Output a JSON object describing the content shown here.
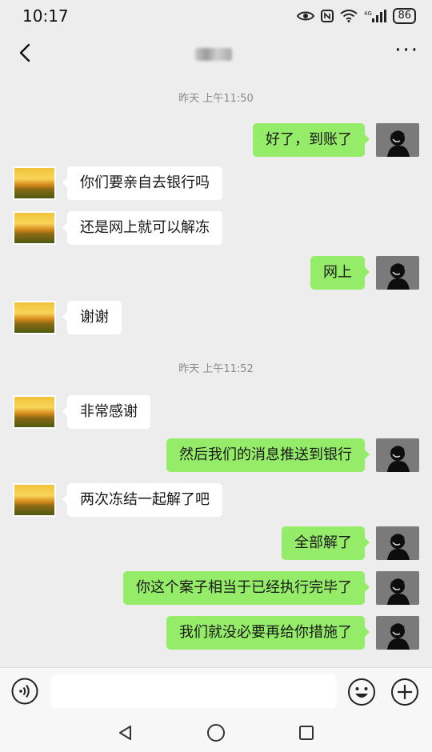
{
  "status_bar": {
    "time": "10:17",
    "icons": [
      "eye-icon",
      "nfc-icon",
      "wifi-icon",
      "signal-4g-icon"
    ],
    "battery": "86"
  },
  "header": {
    "back_icon": "chevron-left-icon",
    "more_icon": "more-dots-icon",
    "more_label": "···"
  },
  "chat": {
    "timestamps": [
      "昨天 上午11:50",
      "昨天 上午11:52"
    ],
    "messages": [
      {
        "side": "right",
        "text": "好了，到账了"
      },
      {
        "side": "left",
        "text": "你们要亲自去银行吗"
      },
      {
        "side": "left",
        "text": "还是网上就可以解冻"
      },
      {
        "side": "right",
        "text": "网上"
      },
      {
        "side": "left",
        "text": "谢谢"
      },
      {
        "side": "left",
        "text": "非常感谢"
      },
      {
        "side": "right",
        "text": "然后我们的消息推送到银行"
      },
      {
        "side": "left",
        "text": "两次冻结一起解了吧"
      },
      {
        "side": "right",
        "text": "全部解了"
      },
      {
        "side": "right",
        "text": "你这个案子相当于已经执行完毕了"
      },
      {
        "side": "right",
        "text": "我们就没必要再给你措施了"
      }
    ]
  },
  "input_bar": {
    "value": "",
    "icons": [
      "voice-icon",
      "emoji-icon",
      "plus-icon"
    ]
  },
  "system_nav": {
    "icons": [
      "back-triangle-icon",
      "home-circle-icon",
      "recents-square-icon"
    ]
  },
  "colors": {
    "background": "#ededed",
    "outgoing_bubble": "#95ec69",
    "incoming_bubble": "#ffffff",
    "timestamp_text": "#8a8a8a"
  }
}
